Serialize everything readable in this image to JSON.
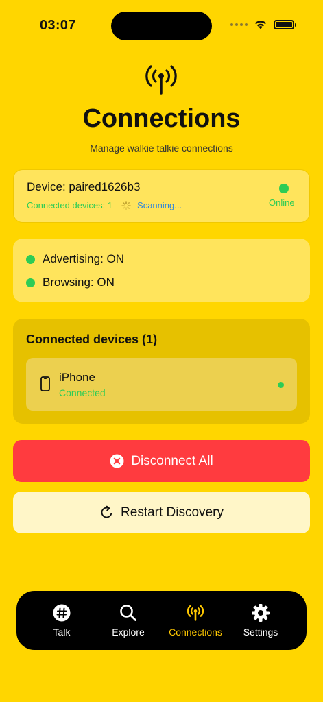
{
  "status_bar": {
    "time": "03:07"
  },
  "header": {
    "icon": "antenna-icon",
    "title": "Connections",
    "subtitle": "Manage walkie talkie connections"
  },
  "device_card": {
    "name": "Device: paired1626b3",
    "connected_count": "Connected devices: 1",
    "scanning": "Scanning...",
    "online": "Online"
  },
  "status": {
    "advertising": "Advertising: ON",
    "browsing": "Browsing: ON"
  },
  "connected_devices": {
    "title": "Connected devices (1)",
    "items": [
      {
        "name": "iPhone",
        "status": "Connected",
        "icon": "phone-icon"
      }
    ]
  },
  "actions": {
    "disconnect_all": "Disconnect All",
    "restart_discovery": "Restart Discovery"
  },
  "tabs": [
    {
      "label": "Talk",
      "icon": "hashtag-icon",
      "active": false
    },
    {
      "label": "Explore",
      "icon": "search-icon",
      "active": false
    },
    {
      "label": "Connections",
      "icon": "antenna-icon",
      "active": true
    },
    {
      "label": "Settings",
      "icon": "gear-icon",
      "active": false
    }
  ],
  "colors": {
    "background": "#FFD600",
    "accent_active": "#FFC800",
    "online_green": "#2ECC55",
    "danger": "#FF3B3F",
    "scanning_blue": "#2E86DE"
  }
}
